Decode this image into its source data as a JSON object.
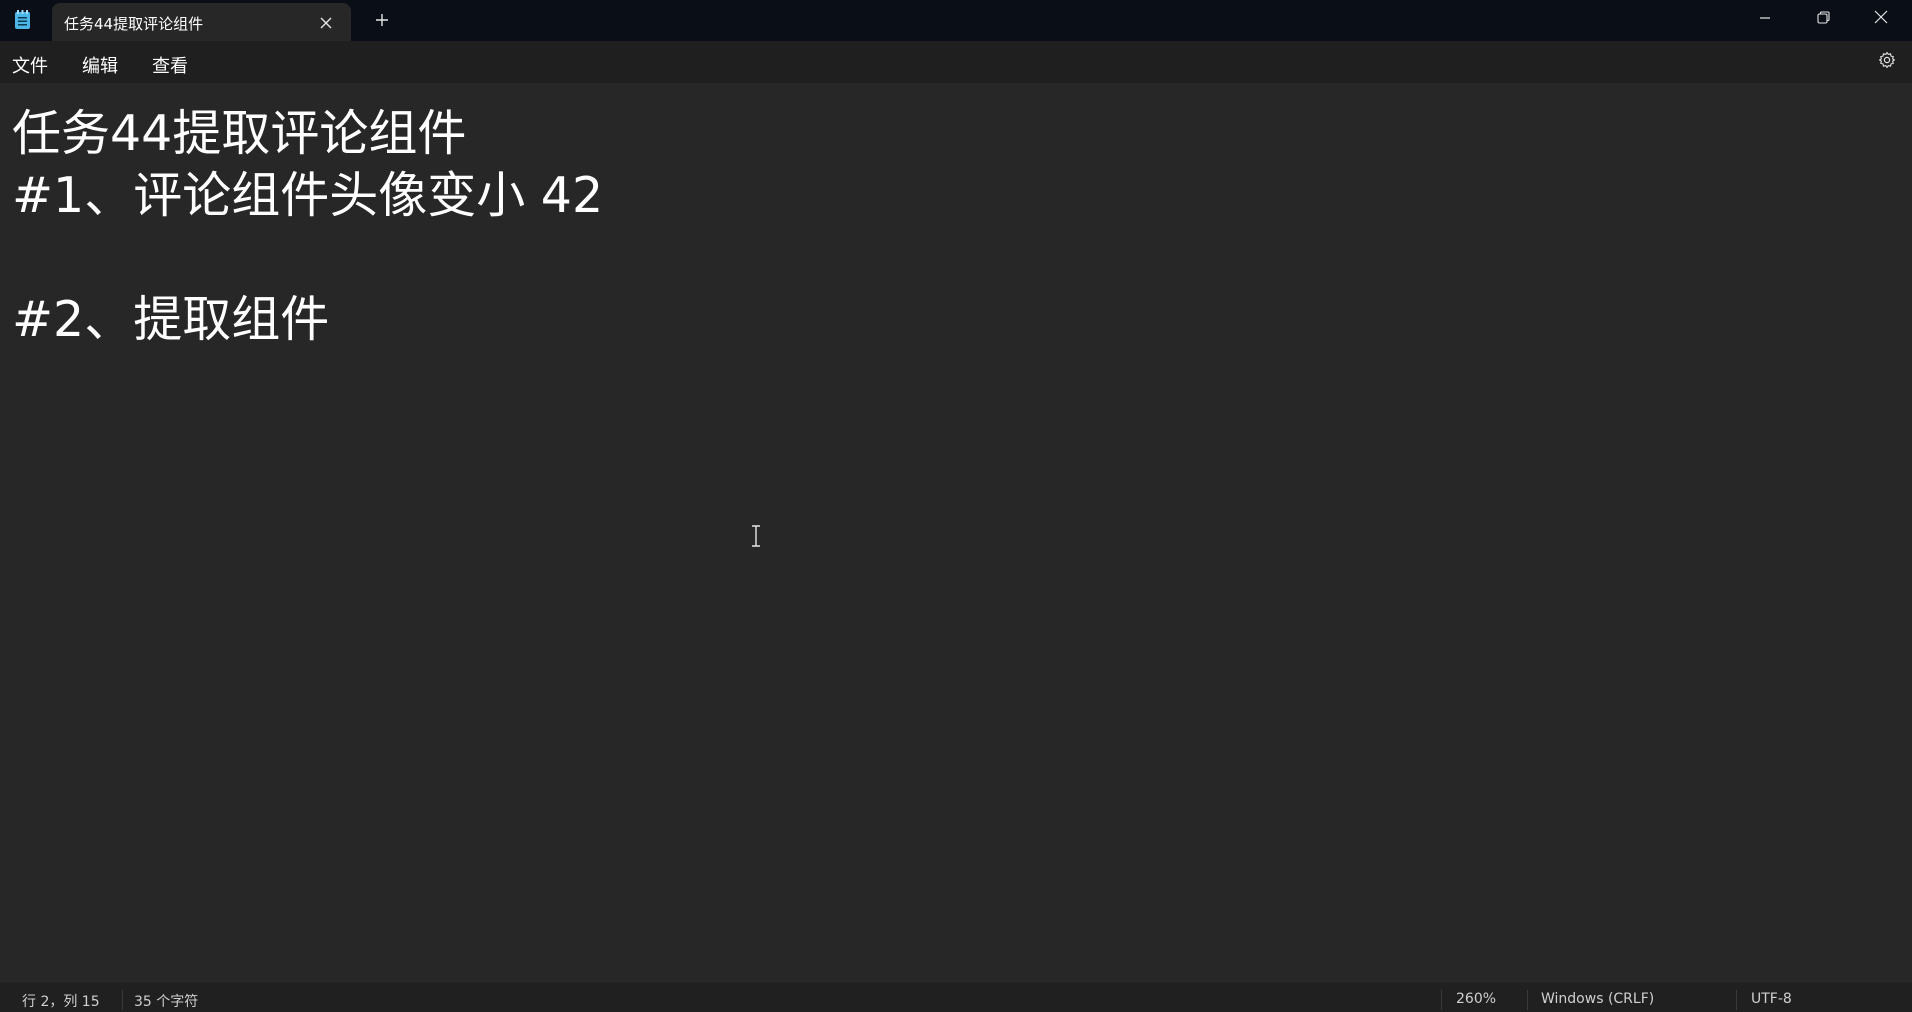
{
  "tab": {
    "title": "任务44提取评论组件"
  },
  "menu": {
    "file": "文件",
    "edit": "编辑",
    "view": "查看"
  },
  "icons": {
    "app": "notepad-icon",
    "tab_close": "close-icon",
    "new_tab": "plus-icon",
    "minimize": "minimize-icon",
    "maximize": "restore-icon",
    "close": "close-icon",
    "settings": "gear-icon"
  },
  "editor": {
    "lines": [
      "任务44提取评论组件",
      "#1、评论组件头像变小 42",
      "",
      "#2、提取组件"
    ]
  },
  "status": {
    "position": "行 2，列 15",
    "char_count": "35 个字符",
    "zoom": "260%",
    "line_ending": "Windows (CRLF)",
    "encoding": "UTF-8"
  },
  "colors": {
    "titlebar": "#0a0f17",
    "menubar": "#1f1f1f",
    "editor_bg": "#272727",
    "statusbar": "#202020",
    "text": "#ffffff",
    "app_icon_accent": "#4db6e8"
  }
}
